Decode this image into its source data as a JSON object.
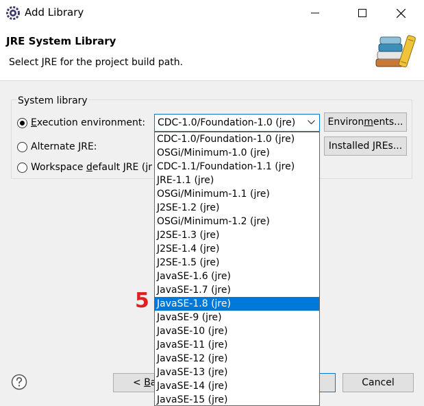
{
  "window": {
    "title": "Add Library"
  },
  "banner": {
    "title": "JRE System Library",
    "description": "Select JRE for the project build path."
  },
  "system_library": {
    "group_label": "System library",
    "options": [
      {
        "pre": "",
        "mnemonic": "E",
        "post": "xecution environment:",
        "selected": true
      },
      {
        "pre": "Alternate ",
        "mnemonic": "J",
        "post": "RE:",
        "selected": false
      },
      {
        "pre": "Workspace ",
        "mnemonic": "d",
        "post": "efault JRE (jr",
        "selected": false
      }
    ],
    "combo_value": "CDC-1.0/Foundation-1.0 (jre)",
    "environments_button": {
      "pre": "Environ",
      "mnemonic": "m",
      "post": "ents..."
    },
    "installed_jres_button": {
      "pre": "Installed JREs...",
      "mnemonic": "",
      "post": ""
    }
  },
  "dropdown": {
    "items": [
      "CDC-1.0/Foundation-1.0 (jre)",
      "OSGi/Minimum-1.0 (jre)",
      "CDC-1.1/Foundation-1.1 (jre)",
      "JRE-1.1 (jre)",
      "OSGi/Minimum-1.1 (jre)",
      "J2SE-1.2 (jre)",
      "OSGi/Minimum-1.2 (jre)",
      "J2SE-1.3 (jre)",
      "J2SE-1.4 (jre)",
      "J2SE-1.5 (jre)",
      "JavaSE-1.6 (jre)",
      "JavaSE-1.7 (jre)",
      "JavaSE-1.8 (jre)",
      "JavaSE-9 (jre)",
      "JavaSE-10 (jre)",
      "JavaSE-11 (jre)",
      "JavaSE-12 (jre)",
      "JavaSE-13 (jre)",
      "JavaSE-14 (jre)",
      "JavaSE-15 (jre)"
    ],
    "selected_index": 12
  },
  "annotation": {
    "text": "5",
    "color": "#e02020"
  },
  "footer": {
    "back_label_visible": "< Ba",
    "back_mnemonic_index": 2,
    "cancel_label": "Cancel"
  },
  "colors": {
    "accent": "#0078d7",
    "selection": "#0078d7"
  },
  "icons": {
    "app": "eclipse-gear-icon",
    "banner": "library-books-icon",
    "help": "help-icon",
    "minimize": "minimize-icon",
    "maximize": "maximize-icon",
    "close": "close-icon",
    "combo": "chevron-down-icon"
  }
}
